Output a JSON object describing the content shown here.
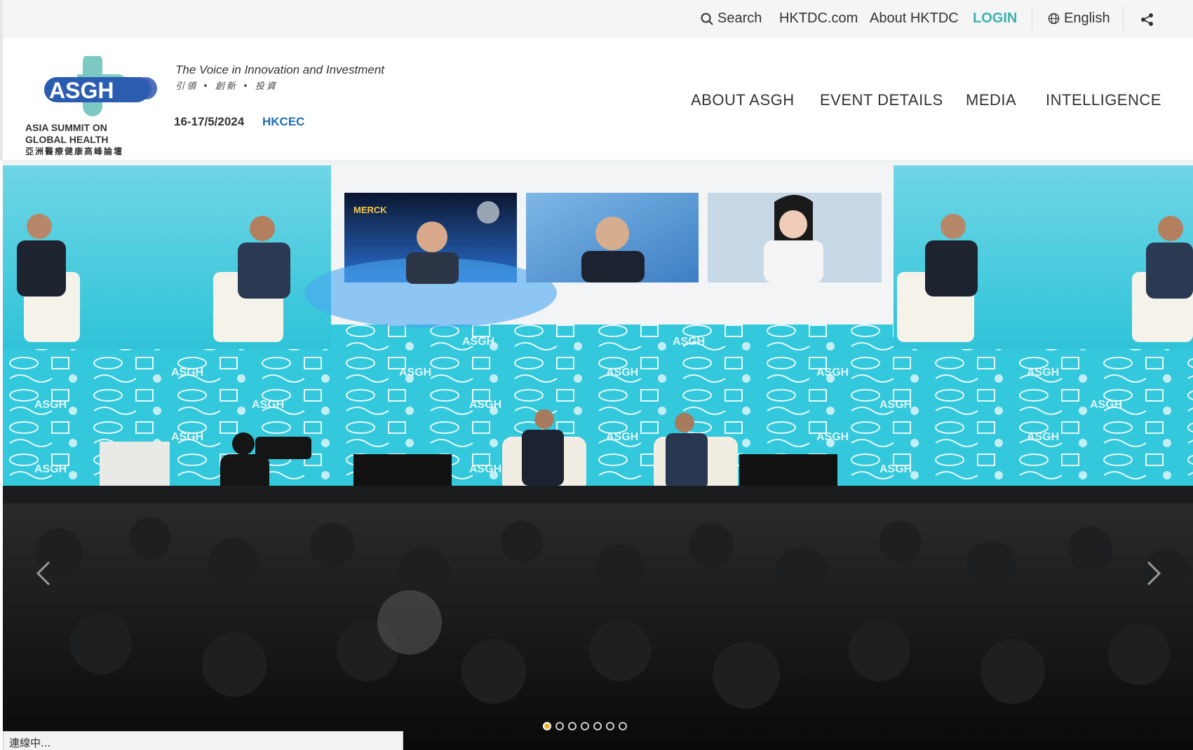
{
  "utility": {
    "search_label": "Search",
    "hktdc_label": "HKTDC.com",
    "about_label": "About HKTDC",
    "login_label": "LOGIN",
    "language_label": "English"
  },
  "header": {
    "logo": {
      "acronym": "ASGH",
      "name_line1": "ASIA SUMMIT ON",
      "name_line2": "GLOBAL HEALTH",
      "name_zh": "亞洲醫療健康高峰論壇"
    },
    "tagline": "The Voice in Innovation and Investment",
    "tagline_zh": "引領 • 創新 • 投資",
    "date": "16-17/5/2024",
    "venue": "HKCEC"
  },
  "nav": {
    "items": [
      {
        "label": "ABOUT ASGH"
      },
      {
        "label": "EVENT DETAILS"
      },
      {
        "label": "MEDIA"
      },
      {
        "label": "INTELLIGENCE"
      }
    ]
  },
  "hero": {
    "screen_logo_text": "MERCK",
    "backdrop_text": "ASGH",
    "active_slide": 1,
    "slide_count": 7
  },
  "status": {
    "text": "連線中..."
  },
  "colors": {
    "accent_teal": "#3fb3ad",
    "venue_blue": "#1f6fb0",
    "stage_cyan": "#36c9dc",
    "dot_active": "#f0b429"
  }
}
